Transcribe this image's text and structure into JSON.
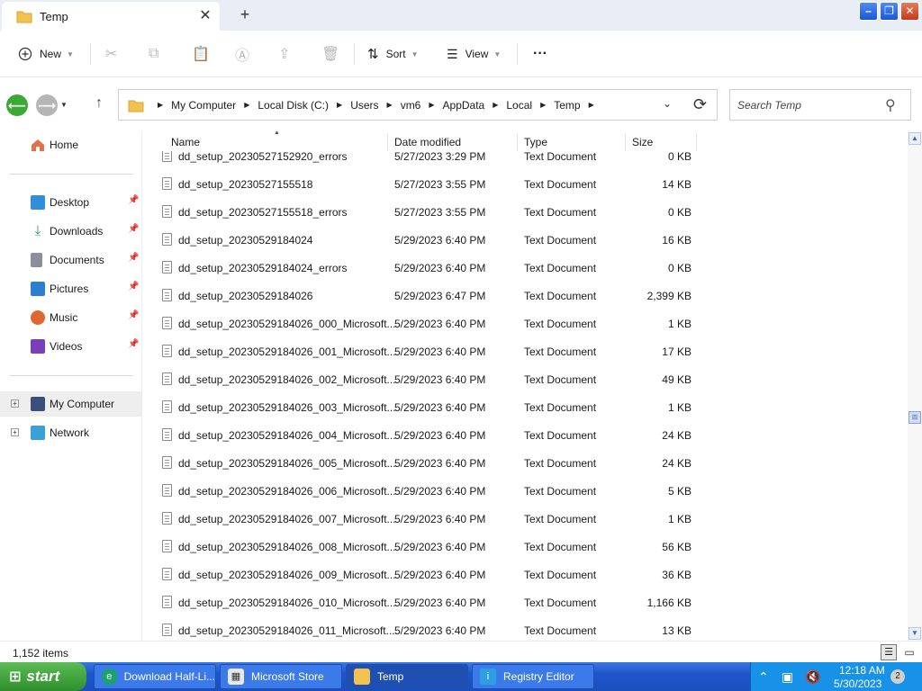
{
  "window": {
    "tab_title": "Temp",
    "tab_close": "✕",
    "tab_add": "+",
    "min": "–",
    "max": "❐",
    "close": "✕"
  },
  "commands": {
    "new": "New",
    "sort": "Sort",
    "view": "View",
    "more": "···"
  },
  "address": {
    "breadcrumb": [
      "My Computer",
      "Local Disk (C:)",
      "Users",
      "vm6",
      "AppData",
      "Local",
      "Temp"
    ],
    "search_placeholder": "Search Temp"
  },
  "sidebar": {
    "home": "Home",
    "quick_access": [
      {
        "label": "Desktop",
        "color": "#2f8fd8"
      },
      {
        "label": "Downloads",
        "color": "#2a9d4f"
      },
      {
        "label": "Documents",
        "color": "#8a8f99"
      },
      {
        "label": "Pictures",
        "color": "#2c7fd0"
      },
      {
        "label": "Music",
        "color": "#e0662e"
      },
      {
        "label": "Videos",
        "color": "#7a3fb8"
      }
    ],
    "tree": [
      {
        "label": "My Computer",
        "expander": "+"
      },
      {
        "label": "Network",
        "expander": "+"
      }
    ]
  },
  "columns": {
    "name": "Name",
    "date": "Date modified",
    "type": "Type",
    "size": "Size"
  },
  "files": [
    {
      "name": "dd_setup_20230527152920_errors",
      "date": "5/27/2023 3:29 PM",
      "type": "Text Document",
      "size": "0 KB"
    },
    {
      "name": "dd_setup_20230527155518",
      "date": "5/27/2023 3:55 PM",
      "type": "Text Document",
      "size": "14 KB"
    },
    {
      "name": "dd_setup_20230527155518_errors",
      "date": "5/27/2023 3:55 PM",
      "type": "Text Document",
      "size": "0 KB"
    },
    {
      "name": "dd_setup_20230529184024",
      "date": "5/29/2023 6:40 PM",
      "type": "Text Document",
      "size": "16 KB"
    },
    {
      "name": "dd_setup_20230529184024_errors",
      "date": "5/29/2023 6:40 PM",
      "type": "Text Document",
      "size": "0 KB"
    },
    {
      "name": "dd_setup_20230529184026",
      "date": "5/29/2023 6:47 PM",
      "type": "Text Document",
      "size": "2,399 KB"
    },
    {
      "name": "dd_setup_20230529184026_000_Microsoft...",
      "date": "5/29/2023 6:40 PM",
      "type": "Text Document",
      "size": "1 KB"
    },
    {
      "name": "dd_setup_20230529184026_001_Microsoft...",
      "date": "5/29/2023 6:40 PM",
      "type": "Text Document",
      "size": "17 KB"
    },
    {
      "name": "dd_setup_20230529184026_002_Microsoft...",
      "date": "5/29/2023 6:40 PM",
      "type": "Text Document",
      "size": "49 KB"
    },
    {
      "name": "dd_setup_20230529184026_003_Microsoft...",
      "date": "5/29/2023 6:40 PM",
      "type": "Text Document",
      "size": "1 KB"
    },
    {
      "name": "dd_setup_20230529184026_004_Microsoft...",
      "date": "5/29/2023 6:40 PM",
      "type": "Text Document",
      "size": "24 KB"
    },
    {
      "name": "dd_setup_20230529184026_005_Microsoft...",
      "date": "5/29/2023 6:40 PM",
      "type": "Text Document",
      "size": "24 KB"
    },
    {
      "name": "dd_setup_20230529184026_006_Microsoft...",
      "date": "5/29/2023 6:40 PM",
      "type": "Text Document",
      "size": "5 KB"
    },
    {
      "name": "dd_setup_20230529184026_007_Microsoft...",
      "date": "5/29/2023 6:40 PM",
      "type": "Text Document",
      "size": "1 KB"
    },
    {
      "name": "dd_setup_20230529184026_008_Microsoft...",
      "date": "5/29/2023 6:40 PM",
      "type": "Text Document",
      "size": "56 KB"
    },
    {
      "name": "dd_setup_20230529184026_009_Microsoft...",
      "date": "5/29/2023 6:40 PM",
      "type": "Text Document",
      "size": "36 KB"
    },
    {
      "name": "dd_setup_20230529184026_010_Microsoft...",
      "date": "5/29/2023 6:40 PM",
      "type": "Text Document",
      "size": "1,166 KB"
    },
    {
      "name": "dd_setup_20230529184026_011_Microsoft...",
      "date": "5/29/2023 6:40 PM",
      "type": "Text Document",
      "size": "13 KB"
    }
  ],
  "status": {
    "item_count": "1,152 items"
  },
  "taskbar": {
    "start": "start",
    "tasks": [
      {
        "label": "Download Half-Li...",
        "icon": "edge-icon",
        "color": "#1ba36b"
      },
      {
        "label": "Microsoft Store",
        "icon": "store-icon",
        "color": "#e8e8e8"
      },
      {
        "label": "Temp",
        "icon": "folder-icon",
        "color": "#f2c14e"
      },
      {
        "label": "Registry Editor",
        "icon": "registry-icon",
        "color": "#2e9fe0"
      }
    ],
    "time": "12:18 AM",
    "date": "5/30/2023",
    "notifications": "2"
  },
  "colors": {
    "accent": "#1f55c9",
    "start_green": "#2f8f2c",
    "back_green": "#3aa935"
  }
}
